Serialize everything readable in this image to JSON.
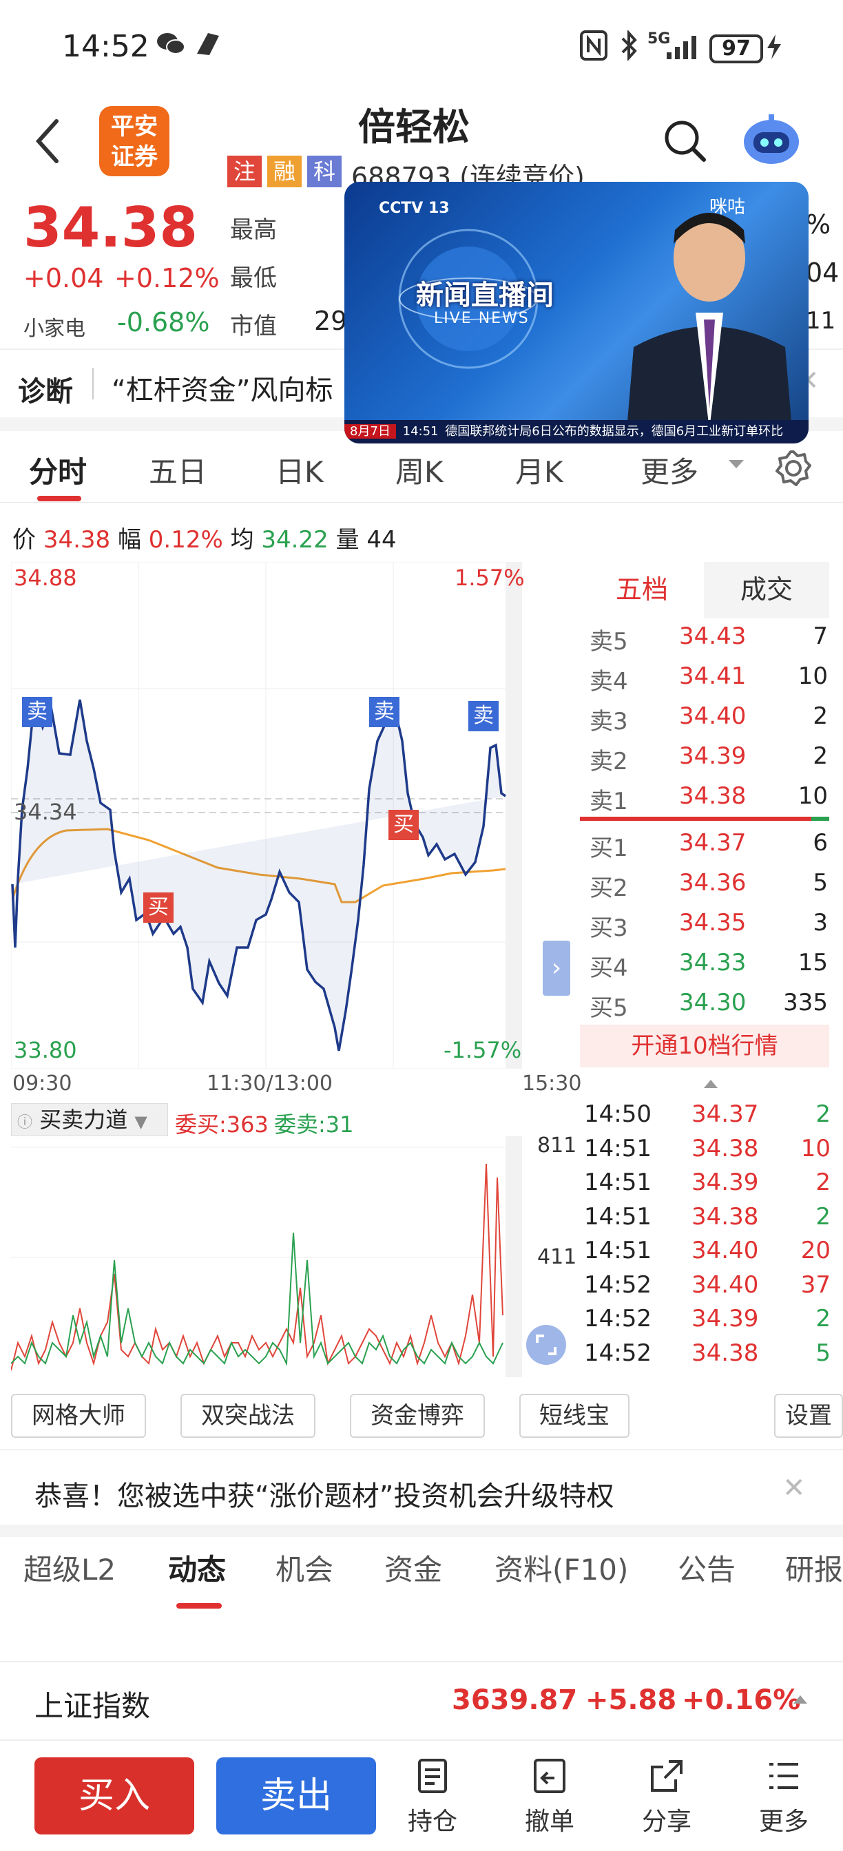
{
  "status": {
    "time": "14:52",
    "battery": "97",
    "network": "5G"
  },
  "header": {
    "logo": "平安\n证券",
    "title": "倍轻松",
    "tags": [
      "注",
      "融",
      "科"
    ],
    "code": "688793 (连续竞价)"
  },
  "pip": {
    "channel": "CCTV 13",
    "show": "新闻直播间",
    "show_en": "LIVE NEWS",
    "ticker": "德国联邦统计局6日公布的数据显示，德国6月工业新订单环比",
    "ticker_time": "14:51",
    "date": "8月7日",
    "brand": "咪咕"
  },
  "quote": {
    "price": "34.38",
    "change": "+0.04",
    "change_pct": "+0.12%",
    "sector": "小家电",
    "sector_pct": "-0.68%",
    "high_label": "最高",
    "low_label": "最低",
    "mcap_label": "市值",
    "mcap_val": "29",
    "right_frag1": "%",
    "right_frag2": "04",
    "right_frag3": "11"
  },
  "diag": {
    "label": "诊断",
    "text": "“杠杆资金”风向标"
  },
  "tabs": [
    "分时",
    "五日",
    "日K",
    "周K",
    "月K",
    "更多"
  ],
  "info_line": {
    "price_label": "价",
    "price": "34.38",
    "amp_label": "幅",
    "amp": "0.12%",
    "avg_label": "均",
    "avg": "34.22",
    "vol_label": "量",
    "vol": "44"
  },
  "chart": {
    "top_price": "34.88",
    "top_pct": "1.57%",
    "bottom_price": "33.80",
    "bottom_pct": "-1.57%",
    "mid_price": "34.34",
    "time_start": "09:30",
    "time_mid": "11:30/13:00",
    "time_end": "15:30",
    "sell_marker": "卖",
    "buy_marker": "买"
  },
  "chart_data": {
    "type": "line",
    "ylim": [
      33.8,
      34.88
    ],
    "series": [
      {
        "name": "价",
        "color": "#1e3a8a"
      },
      {
        "name": "均",
        "color": "#f0a030"
      }
    ]
  },
  "orderbook": {
    "tabs": [
      "五档",
      "成交"
    ],
    "sells": [
      {
        "label": "卖5",
        "price": "34.43",
        "vol": "7"
      },
      {
        "label": "卖4",
        "price": "34.41",
        "vol": "10"
      },
      {
        "label": "卖3",
        "price": "34.40",
        "vol": "2"
      },
      {
        "label": "卖2",
        "price": "34.39",
        "vol": "2"
      },
      {
        "label": "卖1",
        "price": "34.38",
        "vol": "10"
      }
    ],
    "buys": [
      {
        "label": "买1",
        "price": "34.37",
        "vol": "6"
      },
      {
        "label": "买2",
        "price": "34.36",
        "vol": "5"
      },
      {
        "label": "买3",
        "price": "34.35",
        "vol": "3"
      },
      {
        "label": "买4",
        "price": "34.33",
        "vol": "15"
      },
      {
        "label": "买5",
        "price": "34.30",
        "vol": "335"
      }
    ],
    "open10": "开通10档行情"
  },
  "force": {
    "label": "买卖力道",
    "buy": "委买:363",
    "sell": "委卖:31",
    "y_top": "811",
    "y_mid": "411"
  },
  "deals": [
    {
      "t": "14:50",
      "p": "34.37",
      "v": "2",
      "c": "green"
    },
    {
      "t": "14:51",
      "p": "34.38",
      "v": "10",
      "c": "red"
    },
    {
      "t": "14:51",
      "p": "34.39",
      "v": "2",
      "c": "red"
    },
    {
      "t": "14:51",
      "p": "34.38",
      "v": "2",
      "c": "green"
    },
    {
      "t": "14:51",
      "p": "34.40",
      "v": "20",
      "c": "red"
    },
    {
      "t": "14:52",
      "p": "34.40",
      "v": "37",
      "c": "red"
    },
    {
      "t": "14:52",
      "p": "34.39",
      "v": "2",
      "c": "green"
    },
    {
      "t": "14:52",
      "p": "34.38",
      "v": "5",
      "c": "green"
    }
  ],
  "tools": [
    "网格大师",
    "双突战法",
    "资金博弈",
    "短线宝",
    "设置"
  ],
  "banner": "恭喜！您被选中获“涨价题材”投资机会升级特权",
  "bottom_tabs": [
    "超级L2",
    "动态",
    "机会",
    "资金",
    "资料(F10)",
    "公告",
    "研报"
  ],
  "index": {
    "name": "上证指数",
    "value": "3639.87",
    "change": "+5.88",
    "pct": "+0.16%"
  },
  "actions": {
    "buy": "买入",
    "sell": "卖出",
    "hold": "持仓",
    "cancel": "撤单",
    "share": "分享",
    "more": "更多"
  }
}
